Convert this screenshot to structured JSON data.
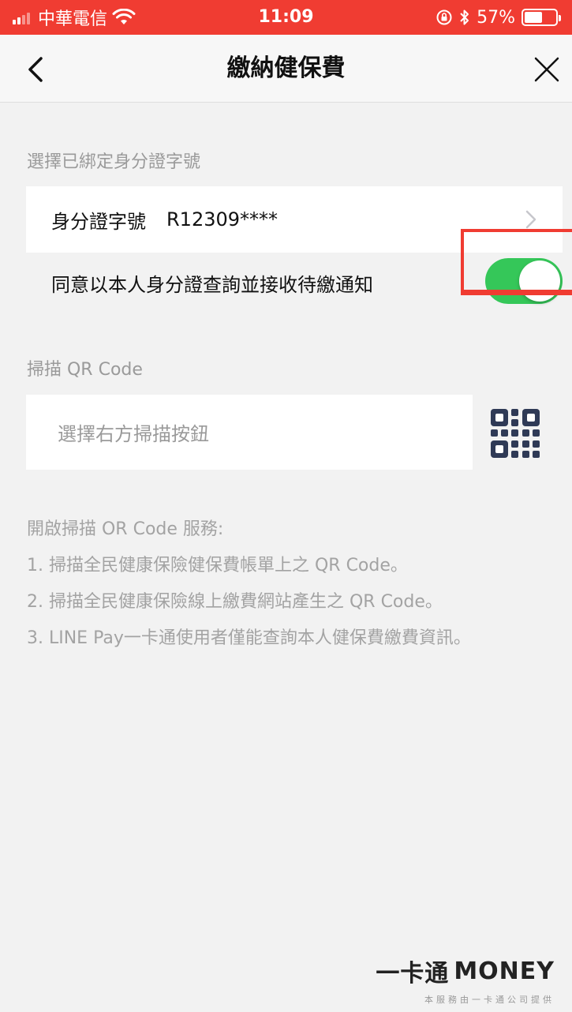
{
  "status_bar": {
    "carrier": "中華電信",
    "time": "11:09",
    "battery_percent": "57%",
    "battery_level": 0.57,
    "icons": [
      "signal-icon",
      "wifi-icon",
      "rotation-lock-icon",
      "bluetooth-icon",
      "battery-icon"
    ]
  },
  "nav": {
    "title": "繳納健保費",
    "back_icon": "chevron-left-icon",
    "close_icon": "close-icon"
  },
  "id_section": {
    "label": "選擇已綁定身分證字號",
    "id_label": "身分證字號",
    "id_value": "R12309****",
    "consent_text": "同意以本人身分證查詢並接收待繳通知",
    "consent_enabled": true,
    "toggle_color": "#35c759",
    "highlight_color": "#f03c32"
  },
  "qr_section": {
    "label": "掃描 QR Code",
    "placeholder": "選擇右方掃描按鈕",
    "button_icon": "qr-code-icon"
  },
  "info": {
    "heading": "開啟掃描 OR Code 服務:",
    "items": [
      "1. 掃描全民健康保險健保費帳單上之 QR Code。",
      "2. 掃描全民健康保險線上繳費網站產生之 QR Code。",
      "3. LINE Pay一卡通使用者僅能查詢本人健保費繳費資訊。"
    ]
  },
  "brand": {
    "logo_prefix": "一卡通",
    "logo_money": "MONEY",
    "subtitle": "本服務由一卡通公司提供"
  },
  "colors": {
    "status_bar": "#f03c32",
    "background": "#f2f2f2"
  }
}
